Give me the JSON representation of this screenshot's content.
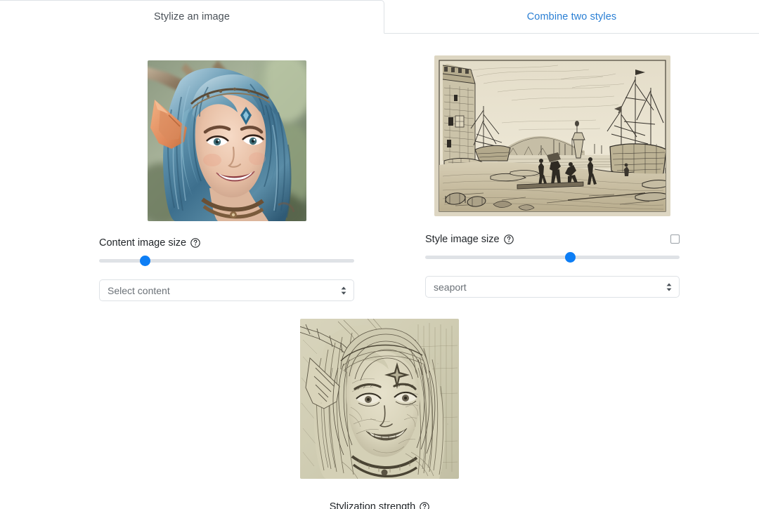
{
  "tabs": [
    {
      "label": "Stylize an image",
      "active": true,
      "name": "tab-stylize-an-image"
    },
    {
      "label": "Combine two styles",
      "active": false,
      "name": "tab-combine-two-styles"
    }
  ],
  "theme": {
    "accent": "#0d7ef5",
    "link": "#2a7fd4",
    "text": "#212529",
    "muted": "#6b7177",
    "border": "#dee2e6",
    "track": "#dfe2e6",
    "background": "#ffffff"
  },
  "content_panel": {
    "image": {
      "alt": "Portrait of a smiling elf woman with long blue hair, pointed ears and a blue gem on her forehead",
      "name": "content-image-preview"
    },
    "size_label": "Content image size",
    "help_icon": "help-circle-icon",
    "slider": {
      "name": "content-image-size-slider",
      "value": 18,
      "min": 0,
      "max": 100
    },
    "select": {
      "name": "content-select",
      "value": "Select content",
      "options": [
        "Select content"
      ]
    }
  },
  "style_panel": {
    "image": {
      "alt": "Etching of a seaport with a stone tower, sailing ships and dock workers",
      "name": "style-image-preview"
    },
    "size_label": "Style image size",
    "help_icon": "help-circle-icon",
    "checkbox": {
      "name": "style-option-checkbox",
      "checked": false
    },
    "slider": {
      "name": "style-image-size-slider",
      "value": 57,
      "min": 0,
      "max": 100
    },
    "select": {
      "name": "style-select",
      "value": "seaport",
      "options": [
        "seaport"
      ]
    }
  },
  "result_panel": {
    "image": {
      "alt": "Stylized result: the elf portrait redrawn as a sepia etching sketch",
      "name": "result-image-preview"
    },
    "strength_label": "Stylization strength",
    "help_icon": "help-circle-icon"
  }
}
